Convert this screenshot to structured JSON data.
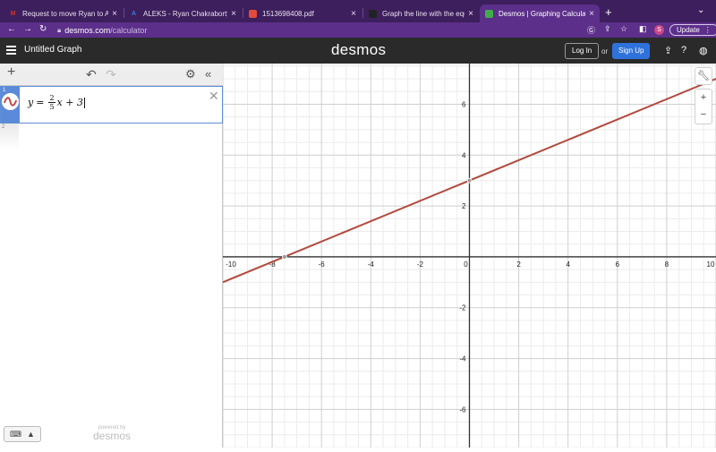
{
  "browser": {
    "tabs": [
      {
        "title": "Request to move Ryan to Algeb",
        "icon": "gmail-icon",
        "fav_glyph": "M",
        "fav_color": "#d93025"
      },
      {
        "title": "ALEKS - Ryan Chakraborty - K",
        "icon": "aleks-icon",
        "fav_glyph": "A",
        "fav_color": "#3b7de0"
      },
      {
        "title": "1513698408.pdf",
        "icon": "pdf-icon",
        "fav_glyph": "▪",
        "fav_color": "#e34b3c"
      },
      {
        "title": "Graph the line with the equatio",
        "icon": "brainly-icon",
        "fav_glyph": "▪",
        "fav_color": "#222222"
      },
      {
        "title": "Desmos | Graphing Calculator",
        "icon": "desmos-tab-icon",
        "fav_glyph": "▪",
        "fav_color": "#3fae49"
      }
    ],
    "active_tab": 4,
    "tab_close": "×",
    "new_tab": "+",
    "url_host": "desmos.com",
    "url_path": "/calculator",
    "profile_initial": "S",
    "update_label": "Update"
  },
  "header": {
    "graph_title": "Untitled Graph",
    "logo": "desmos",
    "login_label": "Log In",
    "or_label": "or",
    "signup_label": "Sign Up"
  },
  "panel": {
    "expressions": [
      {
        "index": "1",
        "lhs": "y",
        "eq": "=",
        "frac_num": "2",
        "frac_den": "5",
        "rest": "x + 3",
        "color": "#c74440"
      },
      {
        "index": "2"
      }
    ],
    "powered_by": "powered by",
    "powered_logo": "desmos"
  },
  "graph": {
    "x_range": [
      -10,
      10
    ],
    "y_range": [
      -7.5,
      7.6
    ],
    "x_ticks": [
      "-10",
      "-8",
      "-6",
      "-4",
      "-2",
      "0",
      "2",
      "4",
      "6",
      "8",
      "10"
    ],
    "y_ticks": [
      "-6",
      "-4",
      "-2",
      "2",
      "4",
      "6"
    ],
    "line": {
      "slope": 0.4,
      "intercept": 3,
      "color": "#b24a3e"
    },
    "points": [
      {
        "x": 0,
        "y": 3
      },
      {
        "x": -7.5,
        "y": 0
      }
    ]
  }
}
